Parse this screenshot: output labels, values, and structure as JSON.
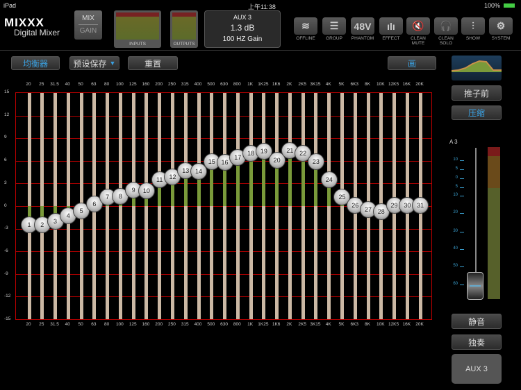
{
  "status": {
    "device": "iPad",
    "time": "上午11:38",
    "battery": "100%"
  },
  "header": {
    "logo_text": "MIXXX",
    "logo_sub": "Digital Mixer",
    "mix": "MIX",
    "gain": "GAIN",
    "inputs": "INPUTS",
    "outputs": "OUTPUTS",
    "display": {
      "channel": "AUX 3",
      "value": "1.3 dB",
      "param": "100 HZ Gain"
    }
  },
  "tools": [
    {
      "label": "OFFLINE",
      "icon": "wifi-icon",
      "glyph": "≋"
    },
    {
      "label": "GROUP",
      "icon": "group-icon",
      "glyph": "☰"
    },
    {
      "label": "PHANTOM",
      "icon": "48v-icon",
      "glyph": "48V"
    },
    {
      "label": "EFFECT",
      "icon": "effect-icon",
      "glyph": "ılı"
    },
    {
      "label": "CLEAN MUTE",
      "icon": "mute-icon",
      "glyph": "🔇"
    },
    {
      "label": "CLEAN SOLO",
      "icon": "headphone-icon",
      "glyph": "🎧"
    },
    {
      "label": "SHOW",
      "icon": "sliders-icon",
      "glyph": "⫶"
    },
    {
      "label": "SYSTEM",
      "icon": "gear-icon",
      "glyph": "⚙"
    }
  ],
  "toolbar": {
    "eq": "均衡器",
    "preset": "预设保存",
    "reset": "重置",
    "draw": "画"
  },
  "side": {
    "prefader": "推子前",
    "compress": "压缩",
    "channel_short": "A 3",
    "mute": "静音",
    "solo": "独奏",
    "channel": "AUX 3",
    "fader_level": "-55",
    "meter_scale": [
      "10",
      "5",
      "0",
      "5",
      "10",
      "20",
      "30",
      "40",
      "50",
      "60"
    ]
  },
  "chart_data": {
    "type": "bar",
    "title": "31-band graphic EQ",
    "ylim": [
      -15,
      15
    ],
    "yticks": [
      "15",
      "12",
      "9",
      "6",
      "3",
      "0",
      "-3",
      "-6",
      "-9",
      "-12",
      "-15"
    ],
    "categories": [
      "20",
      "25",
      "31.5",
      "40",
      "50",
      "63",
      "80",
      "100",
      "125",
      "160",
      "200",
      "250",
      "315",
      "400",
      "500",
      "630",
      "800",
      "1K",
      "1K25",
      "1K6",
      "2K",
      "2K5",
      "3K15",
      "4K",
      "5K",
      "6K3",
      "8K",
      "10K",
      "12K5",
      "16K",
      "20K"
    ],
    "values": [
      -2.5,
      -2.5,
      -2,
      -1.3,
      -0.6,
      0.3,
      1.2,
      1.3,
      2.1,
      2,
      3.5,
      3.9,
      4.7,
      4.6,
      5.9,
      5.8,
      6.4,
      7,
      7.3,
      6.1,
      7.4,
      7,
      5.9,
      3.5,
      1.2,
      0.1,
      -0.5,
      -0.7,
      0.1,
      0.1,
      0.1
    ]
  },
  "colors": {
    "grid": "#aa0000",
    "fill": "#7a9a3a",
    "accent": "#3aa0e0"
  }
}
